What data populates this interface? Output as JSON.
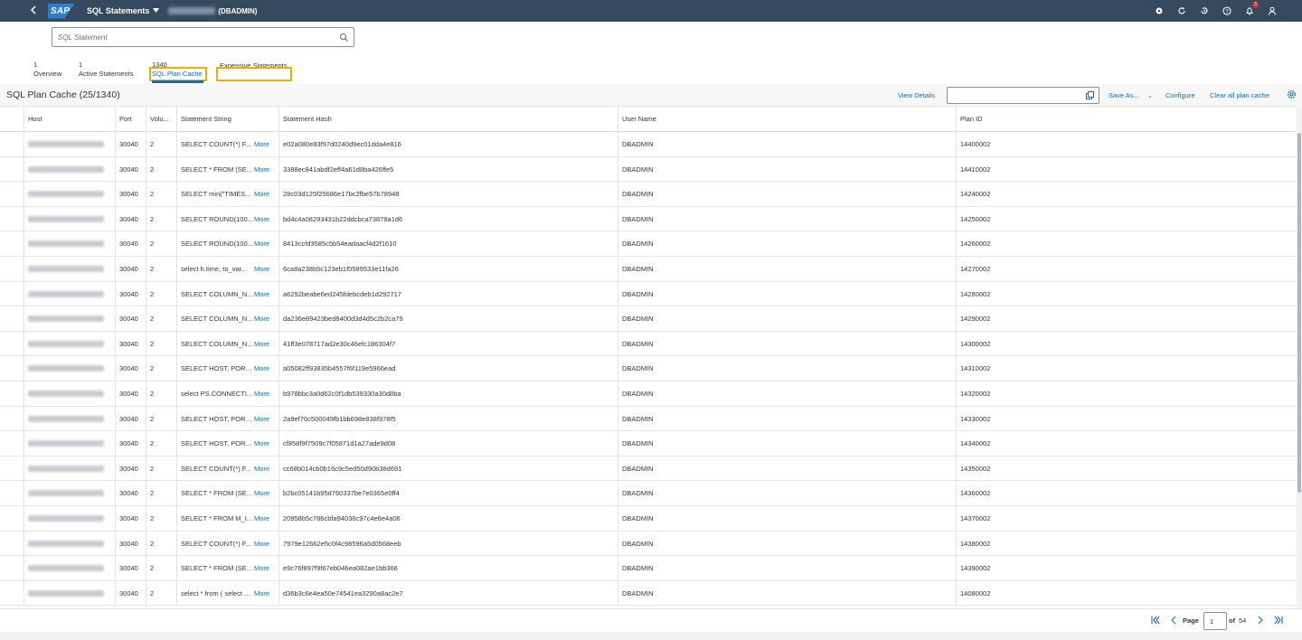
{
  "shell": {
    "logo_text": "SAP",
    "app_title": "SQL Statements",
    "database": "(DBADMIN)",
    "notification_count": "3",
    "icons": [
      "back-icon",
      "caret-down-icon",
      "hierarchy-icon",
      "refresh-icon",
      "history-icon",
      "help-icon",
      "bell-icon",
      "user-icon"
    ]
  },
  "search": {
    "placeholder": "SQL Statement",
    "value": ""
  },
  "tabs": [
    {
      "count": "1",
      "label": "Overview"
    },
    {
      "count": "1",
      "label": "Active Statements"
    },
    {
      "count": "1340",
      "label": "SQL Plan Cache",
      "selected": true
    },
    {
      "count": "",
      "label": "Expensive Statements"
    }
  ],
  "toolbar": {
    "title": "SQL Plan Cache (25/1340)",
    "view_details": "View Details",
    "filter_value": "",
    "save_as": "Save As...",
    "configure": "Configure",
    "clear_all": "Clear all plan cache"
  },
  "table": {
    "headers": [
      "Host",
      "Port",
      "Volu...",
      "Statement String",
      "Statement Hash",
      "User Name",
      "Plan ID"
    ],
    "more_label": "More",
    "rows": [
      {
        "port": "30040",
        "volume": "2",
        "statement": "SELECT COUNT(*) F...",
        "hash": "e02a080e83f97d0240d9ec01dda4e816",
        "user": "DBADMIN",
        "plan_id": "14400002"
      },
      {
        "port": "30040",
        "volume": "2",
        "statement": "SELECT * FROM (SE...",
        "hash": "3388ec841abdf2eff4a61d8ba426ffe5",
        "user": "DBADMIN",
        "plan_id": "14410002"
      },
      {
        "port": "30040",
        "volume": "2",
        "statement": "SELECT min(\"TIMES...",
        "hash": "28c03d125f25686e17bc2fbe57b78948",
        "user": "DBADMIN",
        "plan_id": "14240002"
      },
      {
        "port": "30040",
        "volume": "2",
        "statement": "SELECT ROUND(100...",
        "hash": "bd4c4a08293431b22ddcbca73878a1d6",
        "user": "DBADMIN",
        "plan_id": "14250002"
      },
      {
        "port": "30040",
        "volume": "2",
        "statement": "SELECT ROUND(100...",
        "hash": "8413ccfd3585c5b54eadaacf4d2f1610",
        "user": "DBADMIN",
        "plan_id": "14260002"
      },
      {
        "port": "30040",
        "volume": "2",
        "statement": "select h.time, to_var...",
        "hash": "6ca8a238b5c123eb1f0589533e11fa26",
        "user": "DBADMIN",
        "plan_id": "14270002"
      },
      {
        "port": "30040",
        "volume": "2",
        "statement": "SELECT COLUMN_N...",
        "hash": "a6292beabe6ed245fdebcdeb1d292717",
        "user": "DBADMIN",
        "plan_id": "14280002"
      },
      {
        "port": "30040",
        "volume": "2",
        "statement": "SELECT COLUMN_N...",
        "hash": "da236e89423bed8400d3d4d5c2b2ca79",
        "user": "DBADMIN",
        "plan_id": "14290002"
      },
      {
        "port": "30040",
        "volume": "2",
        "statement": "SELECT COLUMN_N...",
        "hash": "41ff3e078717ad2e30c46efc186304f7",
        "user": "DBADMIN",
        "plan_id": "14300002"
      },
      {
        "port": "30040",
        "volume": "2",
        "statement": "SELECT HOST, PORT...",
        "hash": "a05082ff93835b4557f6f119e5966ead",
        "user": "DBADMIN",
        "plan_id": "14310002"
      },
      {
        "port": "30040",
        "volume": "2",
        "statement": "select PS.CONNECTI...",
        "hash": "b978bbc3a0d62c0f1db539330a30d8ba",
        "user": "DBADMIN",
        "plan_id": "14320002"
      },
      {
        "port": "30040",
        "volume": "2",
        "statement": "SELECT HOST, PORT...",
        "hash": "2a9ef70c500049fb1bb698e838f978f5",
        "user": "DBADMIN",
        "plan_id": "14330002"
      },
      {
        "port": "30040",
        "volume": "2",
        "statement": "SELECT HOST, PORT...",
        "hash": "cf858f9f7509c7f05871d1a27ade9d08",
        "user": "DBADMIN",
        "plan_id": "14340002"
      },
      {
        "port": "30040",
        "volume": "2",
        "statement": "SELECT COUNT(*) F...",
        "hash": "cc68b014cb0b16c9c5ed50d90b38d691",
        "user": "DBADMIN",
        "plan_id": "14350002"
      },
      {
        "port": "30040",
        "volume": "2",
        "statement": "SELECT * FROM (SE...",
        "hash": "b2bc05141b95d760337be7e0365e0ff4",
        "user": "DBADMIN",
        "plan_id": "14360002"
      },
      {
        "port": "30040",
        "volume": "2",
        "statement": "SELECT * FROM M_I...",
        "hash": "20958b5c786cbfa94036c97c4e6e4a06",
        "user": "DBADMIN",
        "plan_id": "14370002"
      },
      {
        "port": "30040",
        "volume": "2",
        "statement": "SELECT COUNT(*) F...",
        "hash": "7979e12662e5c0f4c98596a5d0568eeb",
        "user": "DBADMIN",
        "plan_id": "14380002"
      },
      {
        "port": "30040",
        "volume": "2",
        "statement": "SELECT * FROM (SE...",
        "hash": "e9c76f897f9f67eb046ea082ae1bb366",
        "user": "DBADMIN",
        "plan_id": "14390002"
      },
      {
        "port": "30040",
        "volume": "2",
        "statement": "select * from ( select ...",
        "hash": "d36b3c6e4ea50e74541ea3290a8ac2e7",
        "user": "DBADMIN",
        "plan_id": "14080002"
      }
    ]
  },
  "pager": {
    "page_label": "Page",
    "page_value": "1",
    "of_label": "of",
    "total_pages": "54",
    "icons": [
      "first-page-icon",
      "previous-page-icon",
      "next-page-icon",
      "last-page-icon"
    ]
  },
  "colors": {
    "shell_bg": "#354a5f",
    "accent": "#0a6ed1",
    "focus_outline": "#f0ab00"
  }
}
